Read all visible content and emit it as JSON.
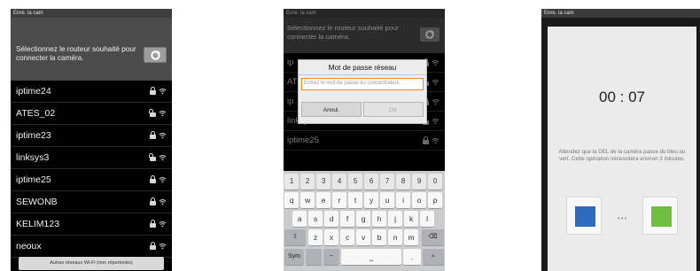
{
  "screen1": {
    "titlebar": "Enre. la cam",
    "prompt": "Sélectionnez le routeur souhaité pour connecter la caméra.",
    "networks": [
      {
        "name": "iptime24",
        "lock": "closed"
      },
      {
        "name": "ATES_02",
        "lock": "open"
      },
      {
        "name": "iptime23",
        "lock": "closed"
      },
      {
        "name": "linksys3",
        "lock": "open"
      },
      {
        "name": "iptime25",
        "lock": "closed"
      },
      {
        "name": "SEWONB",
        "lock": "closed"
      },
      {
        "name": "KELIM123",
        "lock": "closed"
      },
      {
        "name": "neoux",
        "lock": "closed"
      }
    ],
    "other_networks_button": "Autres réseaux Wi-Fi (non répertoriés)"
  },
  "screen2": {
    "titlebar": "Enre. la cam",
    "prompt": "Sélectionnez le routeur souhaité pour connecter la caméra.",
    "background_rows": [
      "ip",
      "AT",
      "ip",
      "linksys3",
      "iptime25"
    ],
    "dialog": {
      "title": "Mot de passe réseau",
      "input_placeholder": "Entrez le mot de passe du concentrateur",
      "cancel_label": "Annul.",
      "ok_label": "OK"
    },
    "keyboard": {
      "row_numbers": [
        "1",
        "2",
        "3",
        "4",
        "5",
        "6",
        "7",
        "8",
        "9",
        "0"
      ],
      "row_q": [
        "q",
        "w",
        "e",
        "r",
        "t",
        "y",
        "u",
        "i",
        "o",
        "p"
      ],
      "row_a": [
        "a",
        "s",
        "d",
        "f",
        "g",
        "h",
        "j",
        "k",
        "l"
      ],
      "row_z": [
        "z",
        "x",
        "c",
        "v",
        "b",
        "n",
        "m"
      ],
      "shift_key": "⇧",
      "backspace_key": "⌫",
      "sym_key": "Sym",
      "period_key": ".",
      "search_key": "⌕"
    }
  },
  "screen3": {
    "titlebar": "Enre. la cam",
    "timer": "00 : 07",
    "message": "Attendez que la DEL de la caméra passe du bleu au vert. Cette opération nécessitera environ 3 minutes.",
    "dots": "•••",
    "colors": {
      "led_from": "#2c6bbd",
      "led_to": "#6fbe44"
    }
  }
}
